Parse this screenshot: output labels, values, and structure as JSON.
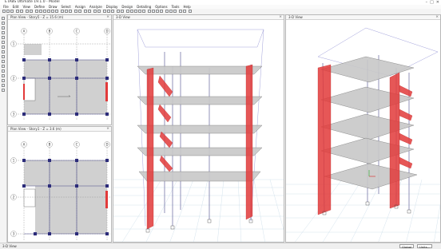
{
  "app": {
    "title": "ETABS Ultimate 19.1.0 - Model",
    "win_controls": [
      "–",
      "□",
      "✕"
    ]
  },
  "menu": [
    "File",
    "Edit",
    "View",
    "Define",
    "Draw",
    "Select",
    "Assign",
    "Analyze",
    "Display",
    "Design",
    "Detailing",
    "Options",
    "Tools",
    "Help"
  ],
  "panes": {
    "plan1": {
      "title": "Plan View - Story5 - Z = 15.6 (m)"
    },
    "plan2": {
      "title": "Plan View - Story1 - Z = 3.6 (m)"
    },
    "view3d_1": {
      "title": "3-D View"
    },
    "view3d_2": {
      "title": "3-D View"
    }
  },
  "grid": {
    "cols": [
      "A",
      "B",
      "C",
      "D"
    ],
    "rows": [
      "1",
      "2",
      "3"
    ]
  },
  "status": {
    "left": "3-D View",
    "units_global": "Global",
    "units": "Units..."
  },
  "colors": {
    "wall": "#e23a3a",
    "slab": "#c8c8c8",
    "frame": "#5a5aa0",
    "ground": "#c9dce9"
  }
}
